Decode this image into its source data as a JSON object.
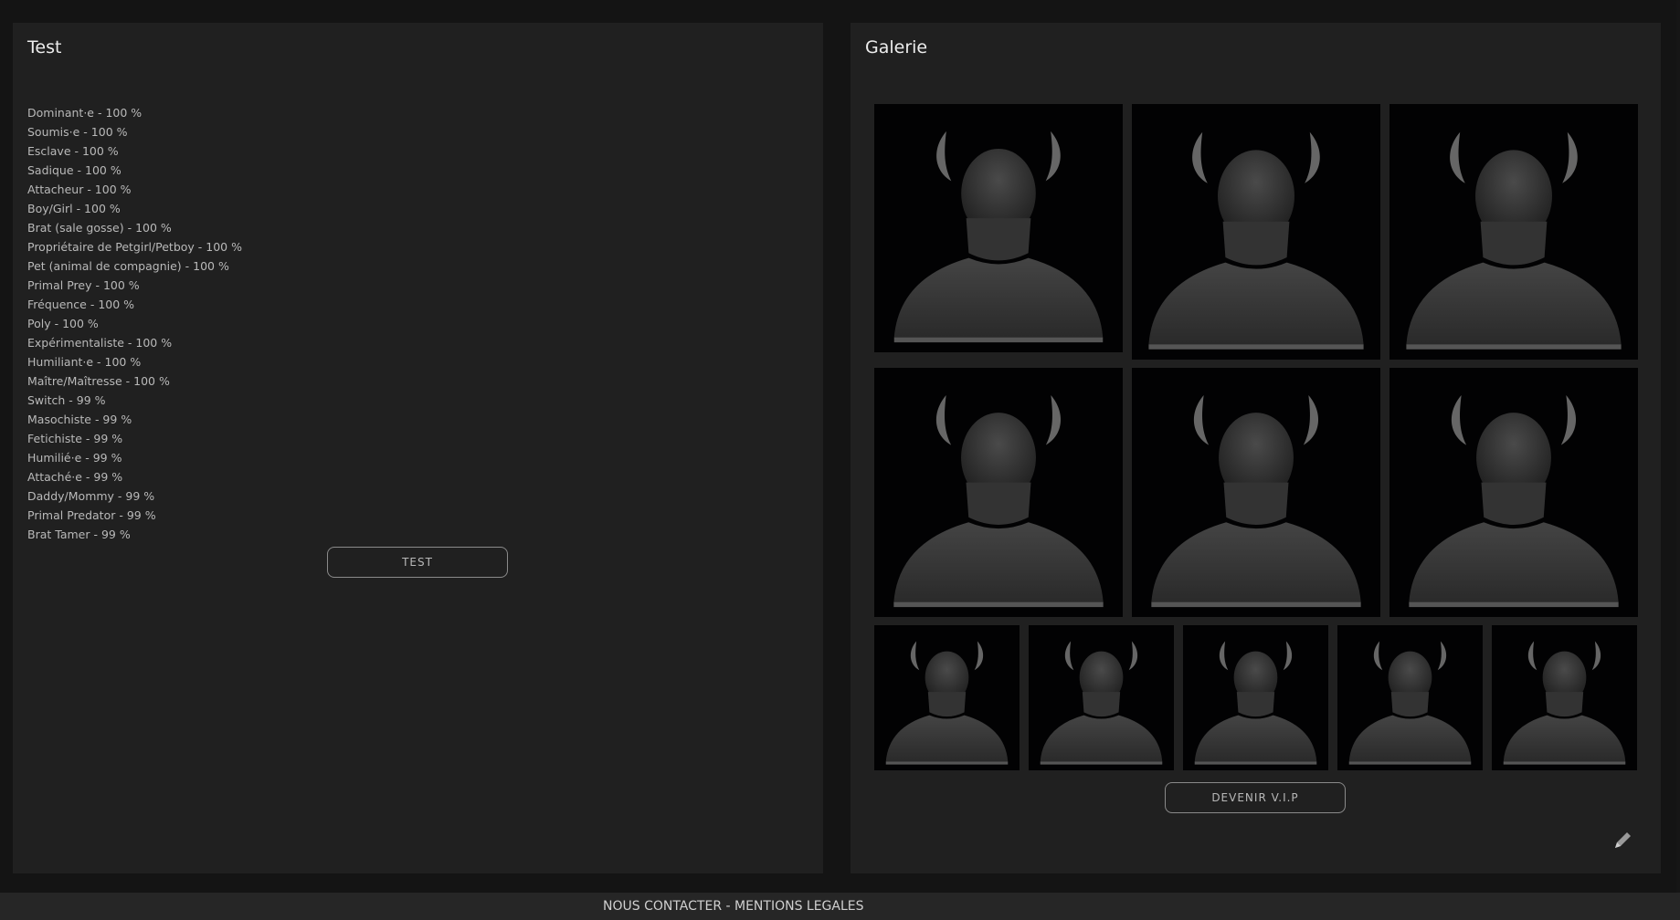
{
  "test_panel": {
    "title": "Test",
    "results": [
      "Dominant·e - 100 %",
      "Soumis·e - 100 %",
      "Esclave - 100 %",
      "Sadique - 100 %",
      "Attacheur - 100 %",
      "Boy/Girl - 100 %",
      "Brat (sale gosse) - 100 %",
      "Propriétaire de Petgirl/Petboy - 100 %",
      "Pet (animal de compagnie) - 100 %",
      "Primal Prey - 100 %",
      "Fréquence - 100 %",
      "Poly - 100 %",
      "Expérimentaliste - 100 %",
      "Humiliant·e - 100 %",
      "Maître/Maîtresse - 100 %",
      "Switch - 99 %",
      "Masochiste - 99 %",
      "Fetichiste - 99 %",
      "Humilié·e - 99 %",
      "Attaché·e - 99 %",
      "Daddy/Mommy - 99 %",
      "Primal Predator - 99 %",
      "Brat Tamer - 99 %"
    ],
    "button_label": "TEST"
  },
  "gallery_panel": {
    "title": "Galerie",
    "image_icon": "horned-silhouette-avatar",
    "vip_button_label": "DEVENIR V.I.P",
    "edit_icon": "pencil-icon"
  },
  "footer": {
    "contact_label": "NOUS CONTACTER",
    "separator": " - ",
    "legal_label": "MENTIONS LEGALES"
  },
  "colors": {
    "page_background": "#141414",
    "panel_background": "#202020",
    "thumbnail_background": "#020203",
    "button_border": "#8a8a8a"
  }
}
